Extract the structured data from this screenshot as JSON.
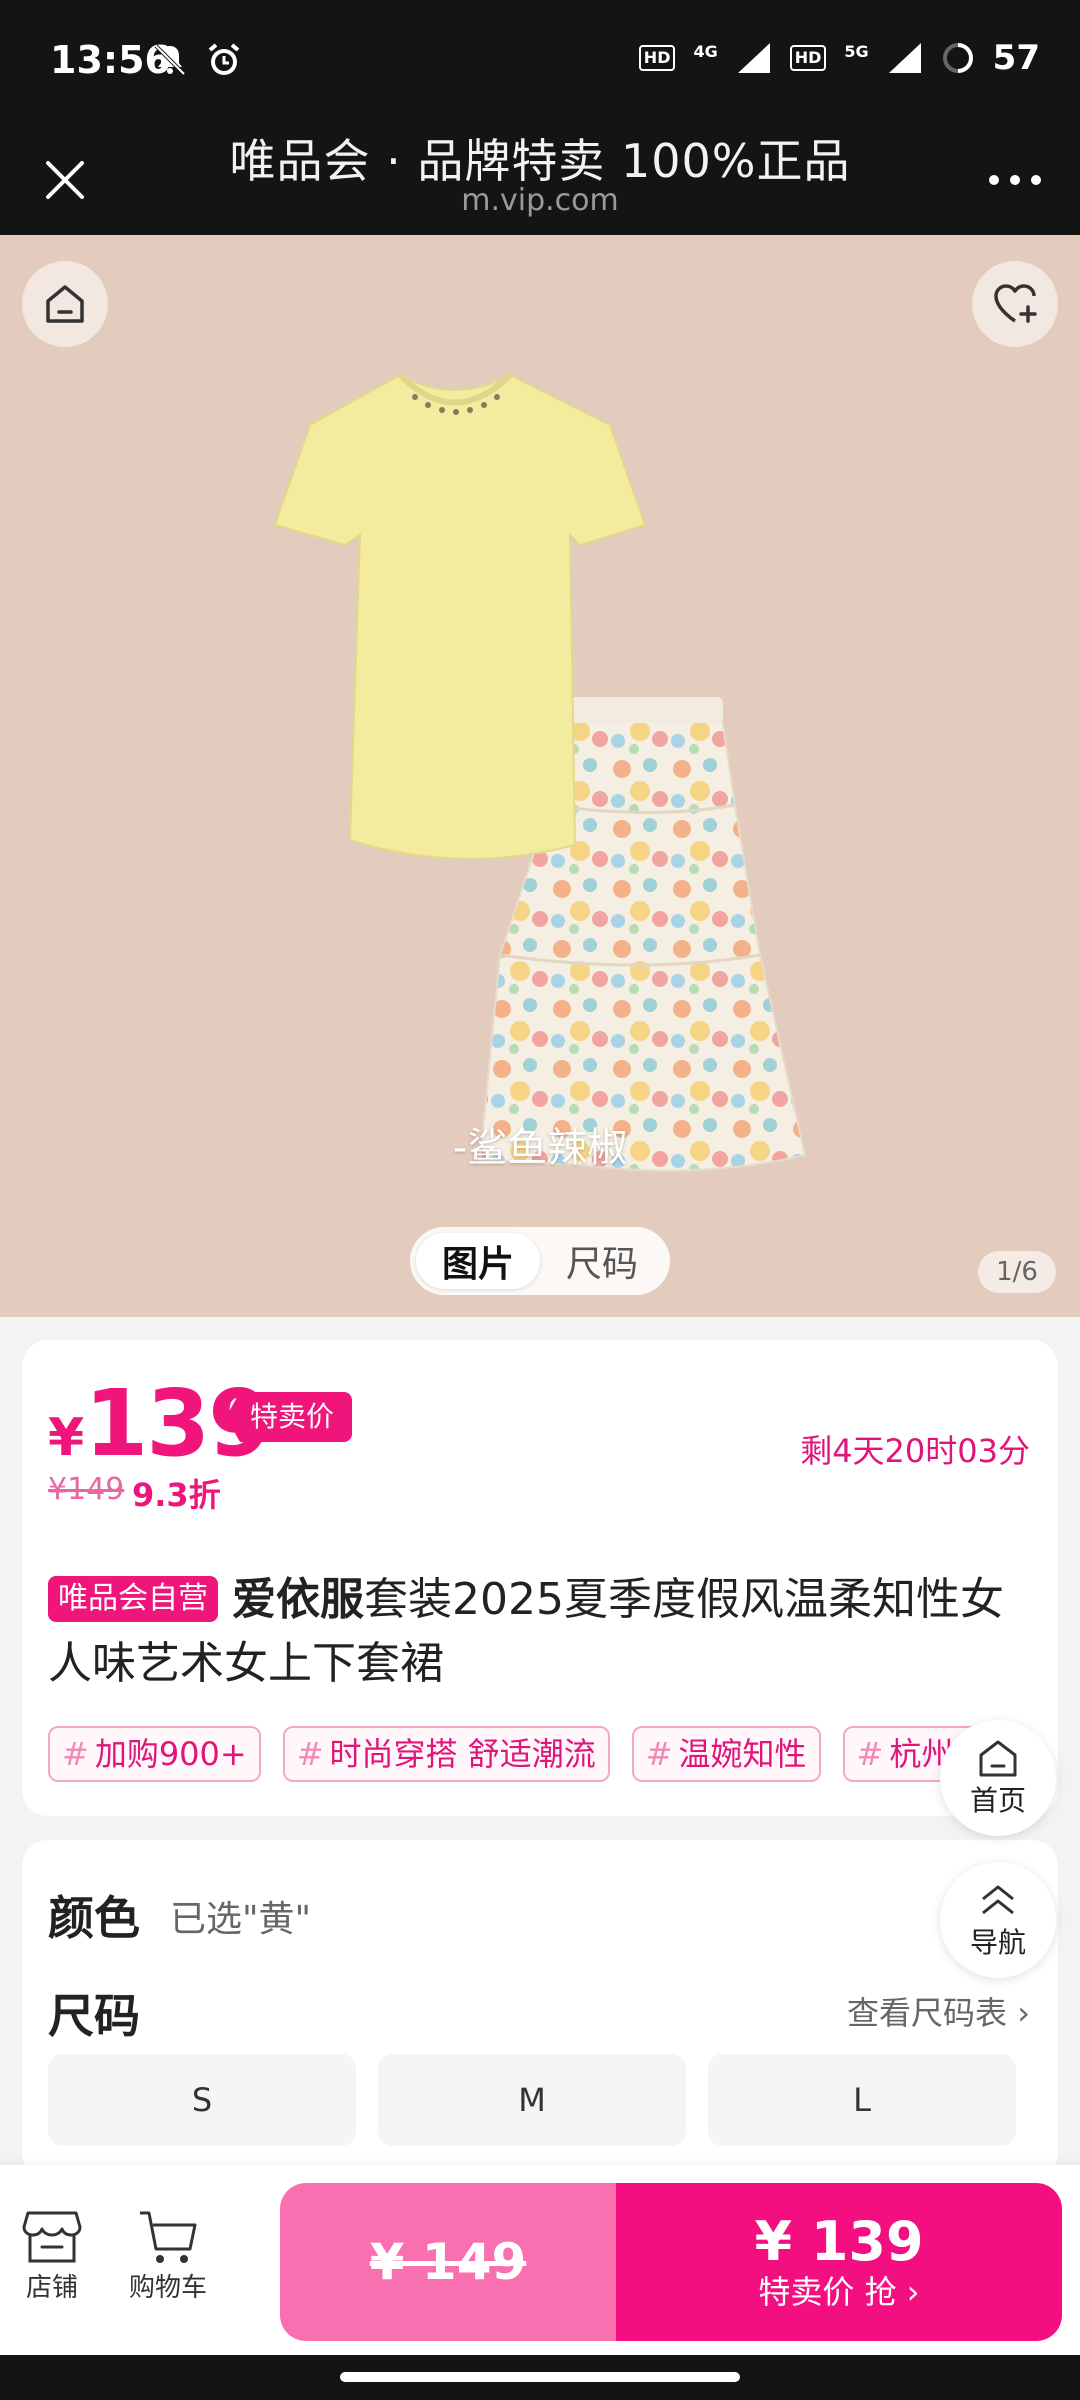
{
  "status_bar": {
    "time": "13:56",
    "battery": "57",
    "net1": "4G",
    "net2": "5G",
    "hd": "HD"
  },
  "header": {
    "title": "唯品会 · 品牌特卖 100%正品",
    "subtitle": "m.vip.com"
  },
  "hero": {
    "watermark": "-鲨鱼辣椒",
    "tabs": [
      "图片",
      "尺码"
    ],
    "active_tab": "图片",
    "page_indicator": "1/6"
  },
  "price": {
    "currency": "¥",
    "value": "139",
    "sale_tag": "特卖价",
    "original": "¥149",
    "discount": "9.3折",
    "countdown": "剩4天20时03分"
  },
  "product": {
    "badge": "唯品会自营",
    "brand": "爱依服",
    "title": "套装2025夏季度假风温柔知性女人味艺术女上下套裙",
    "tags": [
      "加购900+",
      "时尚穿搭 舒适潮流",
      "温婉知性",
      "杭州流行"
    ]
  },
  "floating": {
    "home": "首页",
    "nav": "导航"
  },
  "spec": {
    "color_label": "颜色",
    "color_value": "已选\"黄\"",
    "size_label": "尺码",
    "size_chart": "查看尺码表",
    "sizes": [
      "S",
      "M",
      "L"
    ]
  },
  "bottom": {
    "shop": "店铺",
    "cart": "购物车",
    "orig_price": "¥ 149",
    "buy_price": "¥ 139",
    "buy_label": "特卖价 抢"
  },
  "colors": {
    "accent": "#f0157a",
    "buy_left": "#f970b0",
    "buy_right": "#f30f7f",
    "hero_bg": "#e3ccbd"
  }
}
